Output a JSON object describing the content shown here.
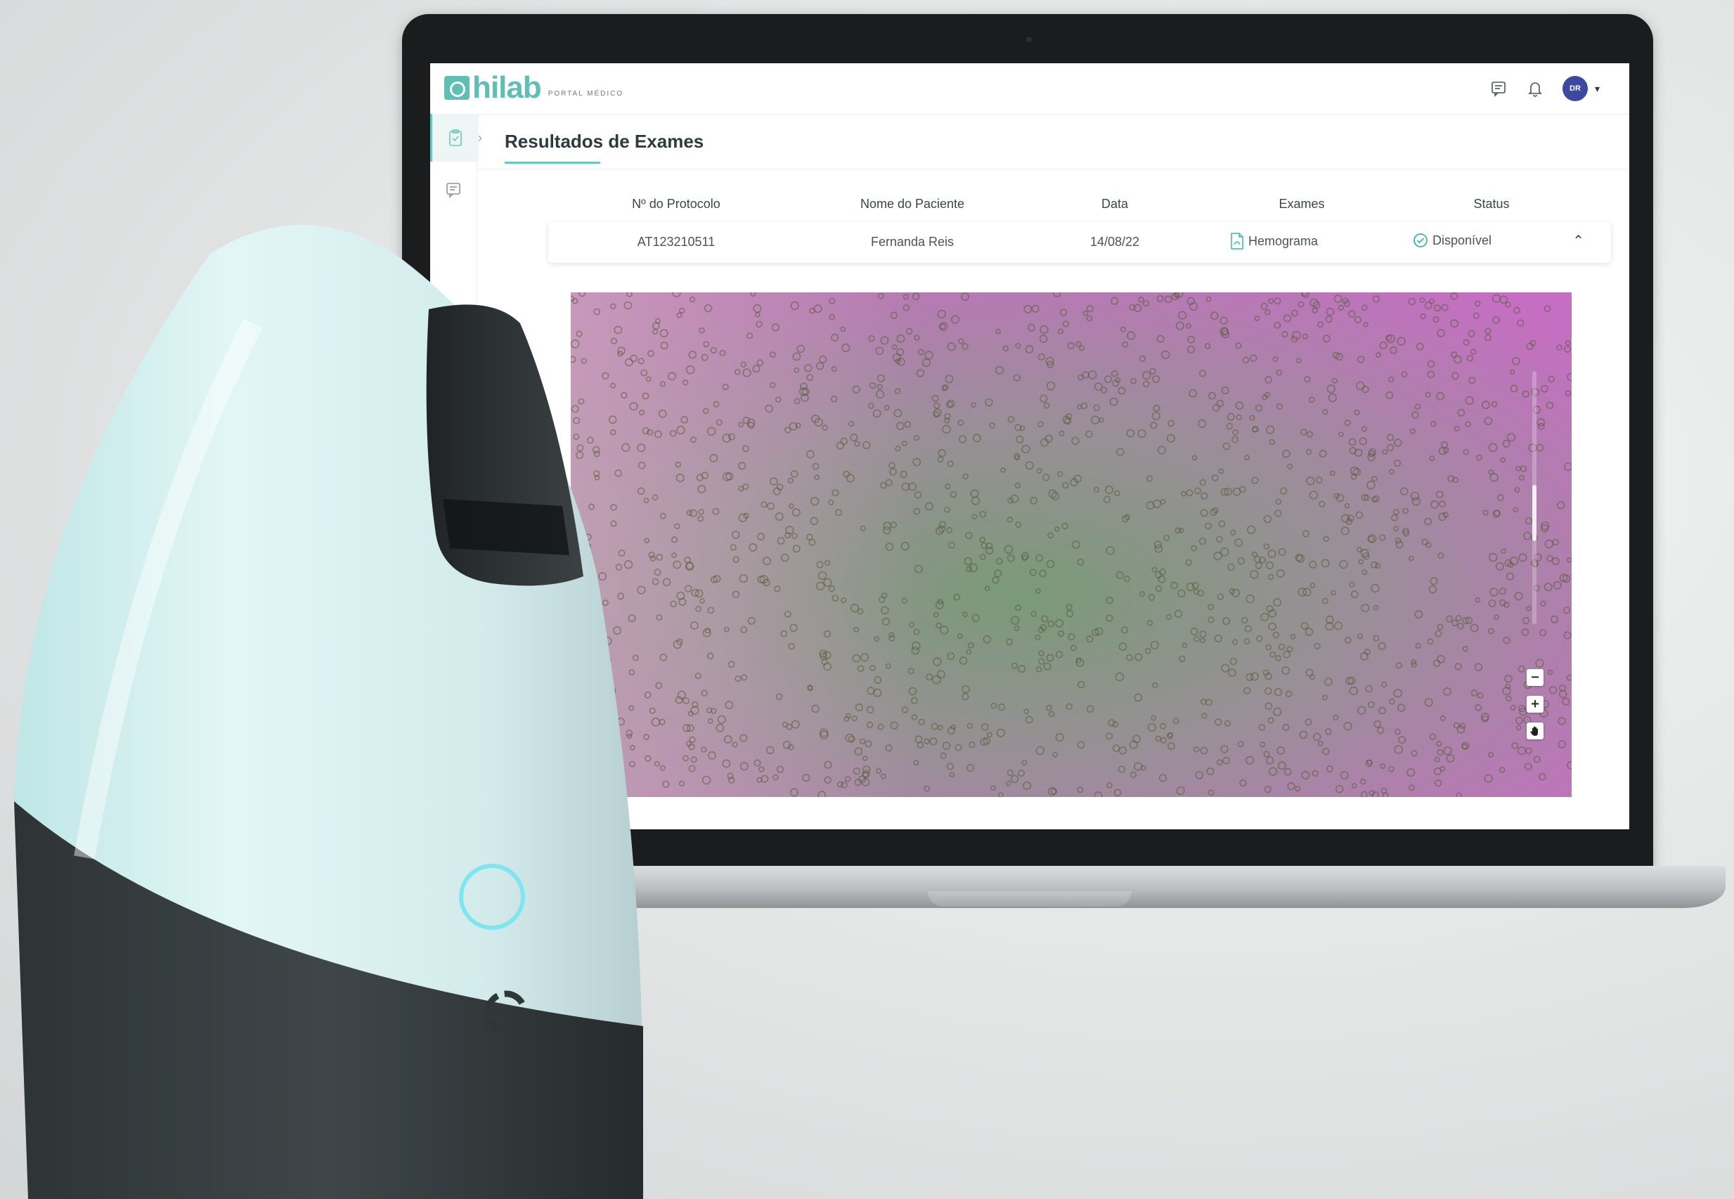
{
  "header": {
    "logo_text": "hilab",
    "logo_subtitle": "PORTAL MÉDICO",
    "user_initials": "DR"
  },
  "page": {
    "title": "Resultados de Exames"
  },
  "table": {
    "columns": [
      "Nº do Protocolo",
      "Nome do Paciente",
      "Data",
      "Exames",
      "Status"
    ],
    "rows": [
      {
        "protocolo": "AT123210511",
        "paciente": "Fernanda Reis",
        "data": "14/08/22",
        "exame": "Hemograma",
        "status": "Disponível"
      }
    ]
  },
  "viewer": {
    "zoom_out": "−",
    "zoom_in": "+"
  },
  "colors": {
    "brand": "#5fbfb4",
    "avatar": "#3b4aa0",
    "status_ok": "#3fb7a6"
  },
  "icons": [
    "chat-icon",
    "bell-icon",
    "clipboard-check-icon",
    "message-icon",
    "pdf-icon",
    "check-circle-icon",
    "chevron-up-icon",
    "hand-icon"
  ]
}
